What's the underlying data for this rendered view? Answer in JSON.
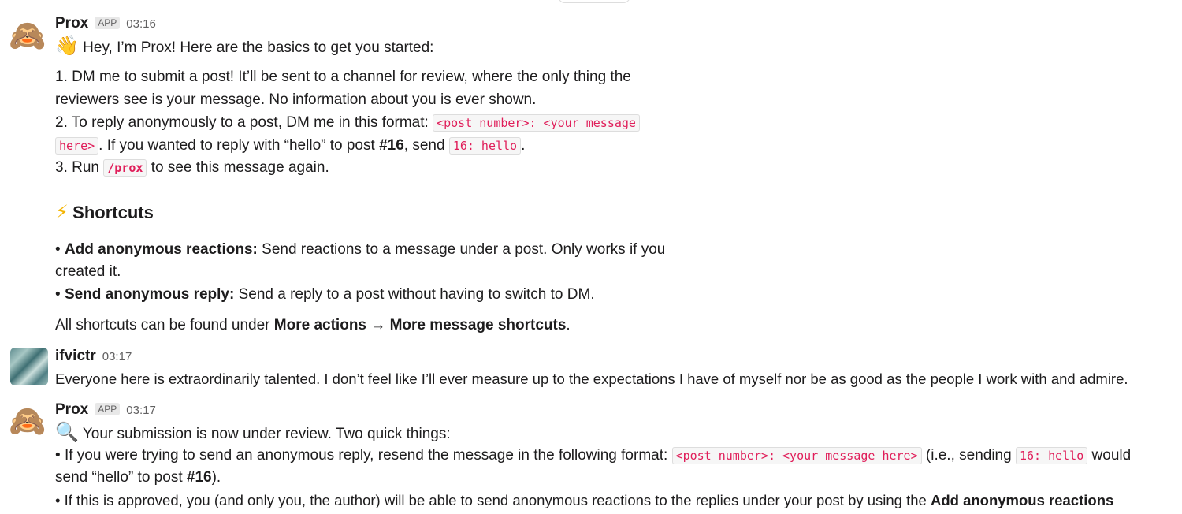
{
  "messages": [
    {
      "sender": "Prox",
      "badge": "APP",
      "time": "03:16",
      "avatar_icon": "see-no-evil-monkey-icon",
      "greeting_emoji": "👋",
      "greeting": "Hey, I’m Prox! Here are the basics to get you started:",
      "step1_line1": "1. DM me to submit a post! It’ll be sent to a channel for review, where the only thing the",
      "step1_line2": "reviewers see is your message. No information about you is ever shown.",
      "step2_text": "2. To reply anonymously to a post, DM me in this format:",
      "step2_code_part1": "<post number>: <your message",
      "step2_code_part2": "here>",
      "step2_mid": ". If you wanted to reply with “hello” to post",
      "step2_post": "#16",
      "step2_send": ", send",
      "step2_example": "16: hello",
      "step2_end": ".",
      "step3_pre": "3. Run",
      "step3_code": "/prox",
      "step3_post": "to see this message again.",
      "shortcuts_emoji": "⚡",
      "shortcuts_heading": "Shortcuts",
      "bullet1_label": "Add anonymous reactions:",
      "bullet1_text": "Send reactions to a message under a post. Only works if you",
      "bullet1_cont": "created it.",
      "bullet2_label": "Send anonymous reply:",
      "bullet2_text": "Send a reply to a post without having to switch to DM.",
      "footer_pre": "All shortcuts can be found under",
      "footer_more_actions": "More actions",
      "footer_arrow": "→",
      "footer_shortcuts": "More message shortcuts",
      "footer_end": "."
    },
    {
      "sender": "ifvictr",
      "time": "03:17",
      "text": "Everyone here is extraordinarily talented. I don’t feel like I’ll ever measure up to the expectations I have of myself nor be as good as the people I work with and admire."
    },
    {
      "sender": "Prox",
      "badge": "APP",
      "time": "03:17",
      "avatar_icon": "see-no-evil-monkey-icon",
      "review_emoji": "🔍",
      "review_text": "Your submission is now under review. Two quick things:",
      "b1_pre": "If you were trying to send an anonymous reply, resend the message in the following format:",
      "b1_code": "<post number>: <your message here>",
      "b1_mid": "(i.e., sending",
      "b1_code2": "16: hello",
      "b1_post": "would",
      "b1_line2_pre": "send “hello” to post",
      "b1_line2_post_num": "#16",
      "b1_line2_end": ").",
      "b2_pre": "If this is approved, you (and only you, the author) will be able to send anonymous reactions to the replies under your post by using the",
      "b2_bold": "Add anonymous reactions"
    }
  ]
}
